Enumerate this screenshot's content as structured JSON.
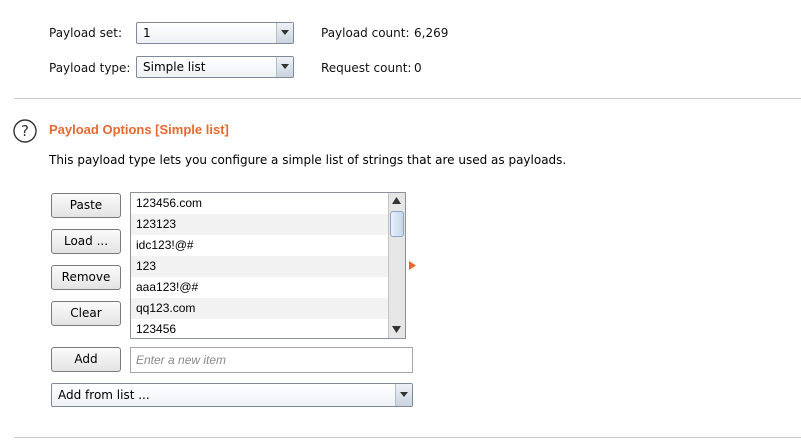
{
  "payload_set": {
    "label": "Payload set:",
    "value": "1",
    "count_label": "Payload count:",
    "count_value": "6,269"
  },
  "payload_type": {
    "label": "Payload type:",
    "value": "Simple list",
    "request_label": "Request count:",
    "request_value": "0"
  },
  "section": {
    "title": "Payload Options [Simple list]",
    "description": "This payload type lets you configure a simple list of strings that are used as payloads."
  },
  "buttons": {
    "paste": "Paste",
    "load": "Load ...",
    "remove": "Remove",
    "clear": "Clear",
    "add": "Add"
  },
  "list_items": [
    "123456.com",
    "123123",
    "idc123!@#",
    "123",
    "aaa123!@#",
    "qq123.com",
    "123456"
  ],
  "new_item": {
    "placeholder": "Enter a new item",
    "value": ""
  },
  "add_from_list": {
    "label": "Add from list ..."
  },
  "colors": {
    "accent": "#e8692f"
  }
}
